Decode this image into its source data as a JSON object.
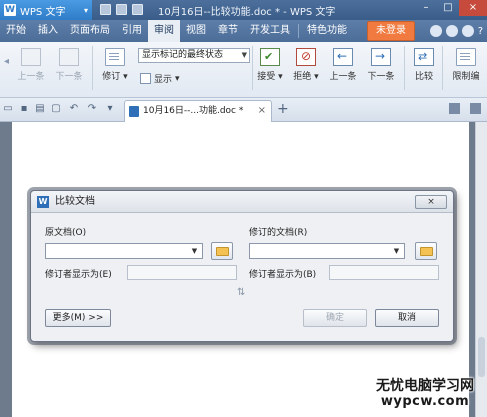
{
  "titlebar": {
    "app_name": "WPS 文字",
    "logo_letter": "W",
    "doc_title": "10月16日--比较功能.doc * - WPS 文字",
    "min_label": "–",
    "max_label": "□",
    "close_label": "×"
  },
  "menu": {
    "items": [
      "开始",
      "插入",
      "页面布局",
      "引用",
      "审阅",
      "视图",
      "章节",
      "开发工具",
      "特色功能"
    ],
    "active_index": 4,
    "login_label": "未登录",
    "help_label": "?"
  },
  "ribbon": {
    "prev_disabled": "上一条",
    "next_disabled": "下一条",
    "revise": "修订",
    "markup_mode": "显示标记的最终状态",
    "show": "显示",
    "accept": "接受",
    "reject": "拒绝",
    "prev": "上一条",
    "next": "下一条",
    "compare": "比较",
    "restrict": "限制编"
  },
  "docbar": {
    "tab_title": "10月16日--...功能.doc *",
    "tab_close": "×",
    "add_tab": "+"
  },
  "dialog": {
    "title": "比较文档",
    "logo_letter": "W",
    "close_label": "×",
    "original_label": "原文档(O)",
    "revised_label": "修订的文档(R)",
    "original_author_label": "修订者显示为(E)",
    "revised_author_label": "修订者显示为(B)",
    "original_value": "",
    "revised_value": "",
    "original_author_value": "",
    "revised_author_value": "",
    "swap_symbol": "⇅",
    "more_label": "更多(M) >>",
    "ok_label": "确定",
    "cancel_label": "取消"
  },
  "watermark": {
    "line1": "无忧电脑学习网",
    "line2": "wypcw.com"
  }
}
